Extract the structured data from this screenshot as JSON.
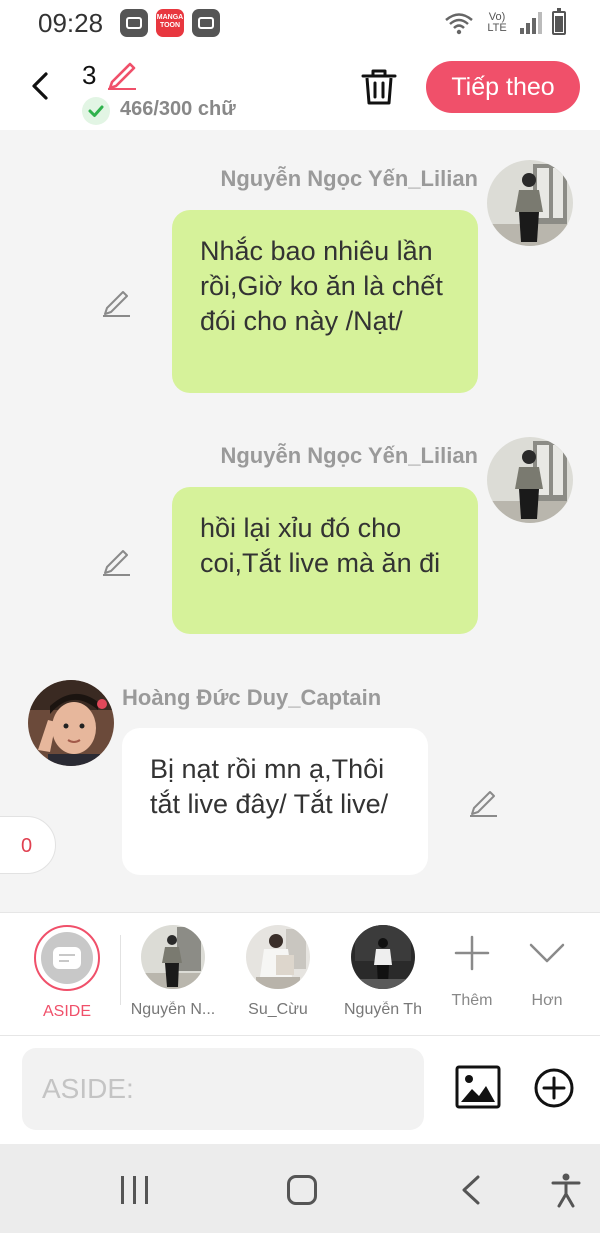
{
  "status_bar": {
    "time": "09:28",
    "app_icons": [
      "video-app-icon",
      "mangatoon-app-icon",
      "video-app-icon"
    ],
    "mangatoon_text": "MANGA TOON",
    "network": "Vo) LTE",
    "icons": [
      "wifi-icon",
      "signal-icon",
      "battery-icon"
    ]
  },
  "header": {
    "chapter_number": "3",
    "word_count": "466/300 chữ",
    "next_button": "Tiếp theo",
    "icons": [
      "back-arrow-icon",
      "pencil-icon",
      "check-icon",
      "trash-icon"
    ]
  },
  "messages": [
    {
      "sender": "Nguyễn Ngọc Yến_Lilian",
      "side": "right",
      "text": "Nhắc bao nhiêu lần rồi,Giờ ko ăn là chết đói cho này /Nạt/"
    },
    {
      "sender": "Nguyễn Ngọc Yến_Lilian",
      "side": "right",
      "text": "hồi lại xỉu đó cho coi,Tắt live mà ăn đi"
    },
    {
      "sender": "Hoàng Đức Duy_Captain",
      "side": "left",
      "text": "Bị nạt rồi mn ạ,Thôi tắt live đây/ Tắt live/"
    }
  ],
  "counter_badge": "0",
  "characters": [
    {
      "label": "ASIDE",
      "selected": true
    },
    {
      "label": "Nguyễn N..."
    },
    {
      "label": "Su_Cừu"
    },
    {
      "label": "Nguyễn Th"
    }
  ],
  "tools": {
    "add_label": "Thêm",
    "more_label": "Hơn"
  },
  "input": {
    "placeholder": "ASIDE:",
    "value": ""
  },
  "colors": {
    "accent": "#f0506a",
    "bubble_green": "#d6f29a",
    "bubble_white": "#ffffff",
    "background": "#f4f4f4"
  }
}
